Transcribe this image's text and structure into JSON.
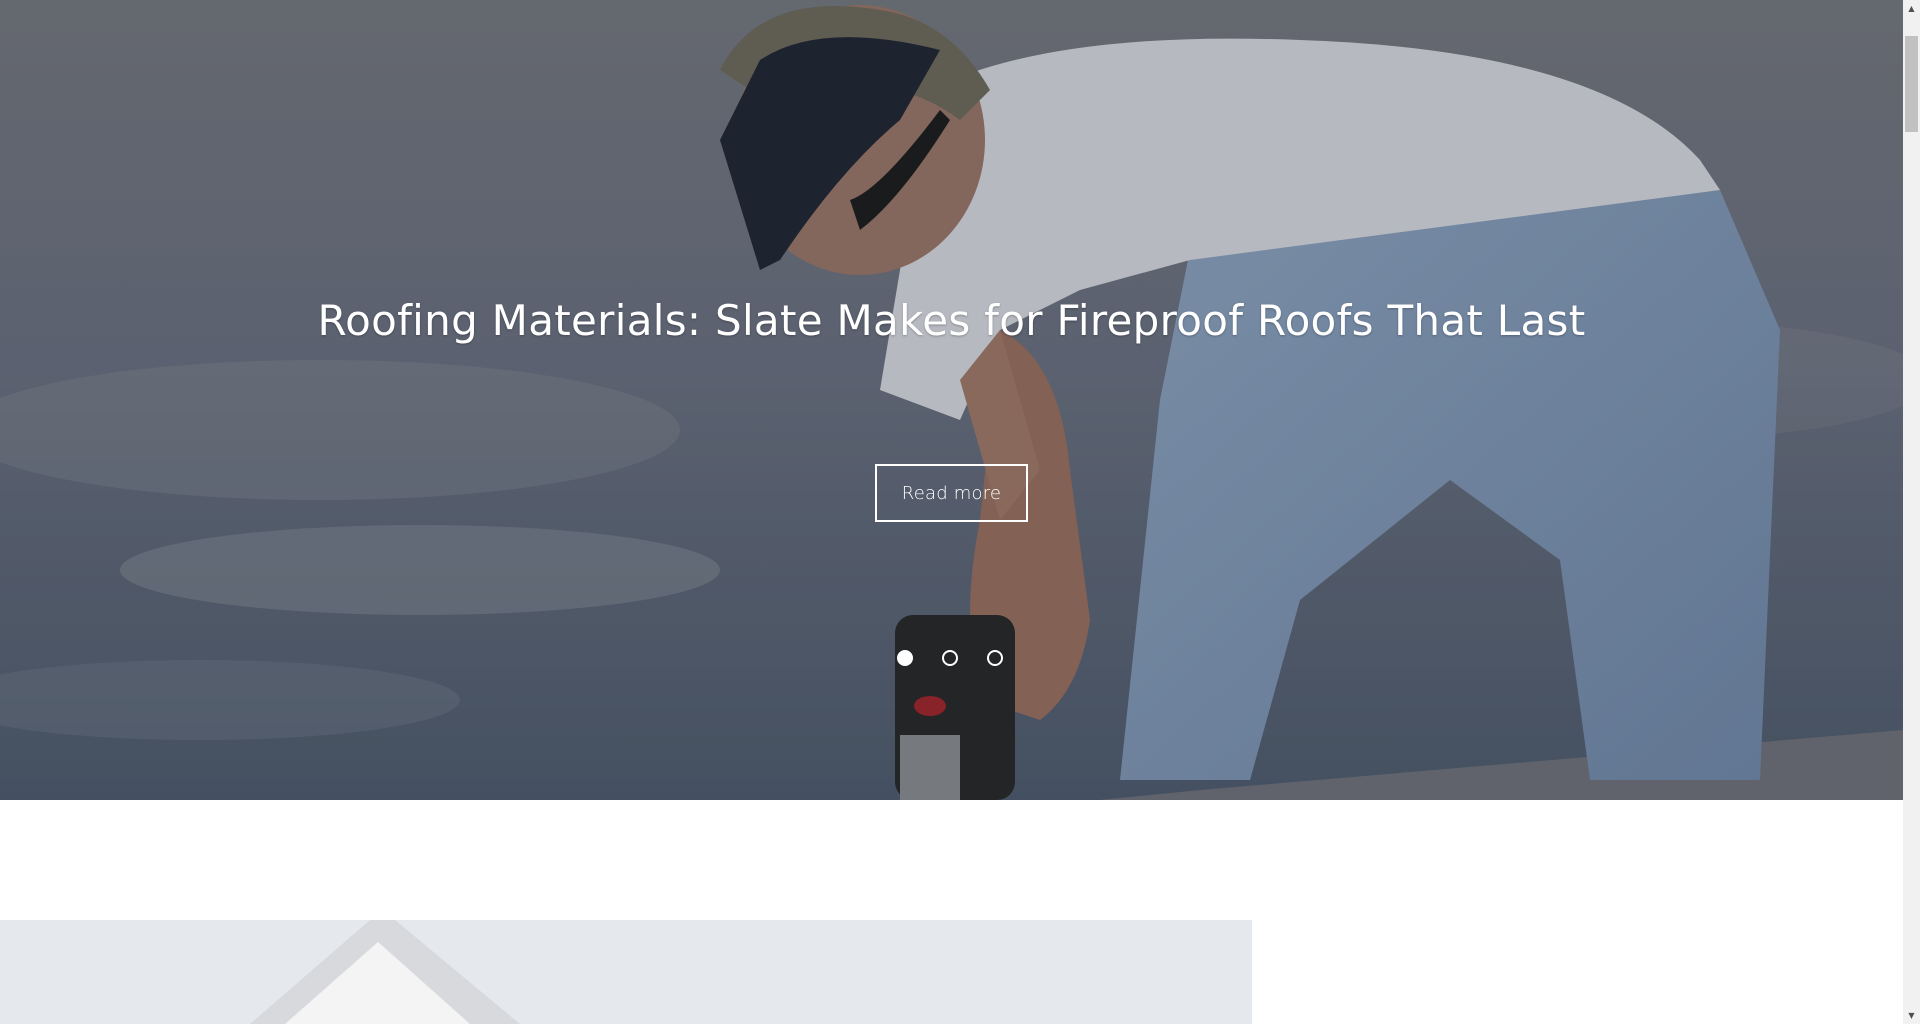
{
  "hero": {
    "title": "Roofing Materials: Slate Makes for Fireproof Roofs That Last",
    "button_label": "Read more",
    "slides": [
      {
        "active": true
      },
      {
        "active": false
      },
      {
        "active": false
      }
    ]
  },
  "scrollbar": {
    "up_icon": "▲",
    "down_icon": "▼"
  }
}
